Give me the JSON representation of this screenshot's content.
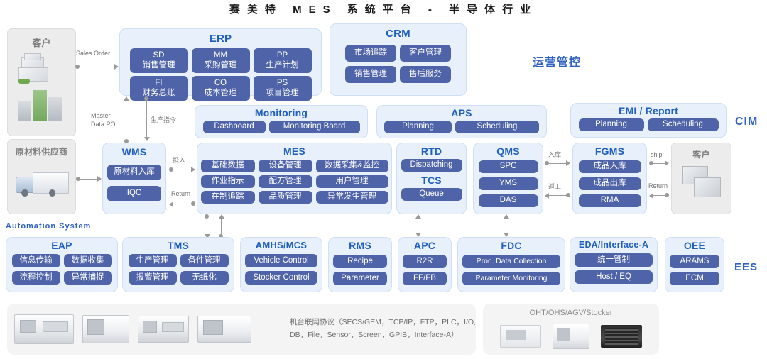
{
  "title": "赛美特 MES 系统平台 - 半导体行业",
  "side_labels": {
    "operation": "运营管控",
    "cim": "CIM",
    "ees": "EES",
    "automation": "Automation  System"
  },
  "actors": {
    "customer_left": "客户",
    "supplier": "原材料供应商",
    "customer_right": "客户"
  },
  "flow_labels": {
    "sales_order": "Sales Order",
    "master_data_po": "Master\nData PO",
    "master_data_po_l1": "Master",
    "master_data_po_l2": "Data PO",
    "production_order": "生产指令",
    "input": "投入",
    "return_wms": "Return",
    "inbound": "入库",
    "rework": "返工",
    "ship": "ship",
    "return_fg": "Return"
  },
  "panels": {
    "erp": {
      "title": "ERP",
      "items": [
        {
          "code": "SD",
          "cn": "销售管理"
        },
        {
          "code": "MM",
          "cn": "采购管理"
        },
        {
          "code": "PP",
          "cn": "生产计划"
        },
        {
          "code": "FI",
          "cn": "财务总账"
        },
        {
          "code": "CO",
          "cn": "成本管理"
        },
        {
          "code": "PS",
          "cn": "项目管理"
        }
      ]
    },
    "crm": {
      "title": "CRM",
      "items": [
        "市场追踪",
        "客户管理",
        "销售管理",
        "售后服务"
      ]
    },
    "monitoring": {
      "title": "Monitoring",
      "items": [
        "Dashboard",
        "Monitoring Board"
      ]
    },
    "aps": {
      "title": "APS",
      "items": [
        "Planning",
        "Scheduling"
      ]
    },
    "emi": {
      "title": "EMI / Report",
      "items": [
        "Planning",
        "Scheduling"
      ]
    },
    "wms": {
      "title": "WMS",
      "items": [
        "原材料入库",
        "IQC"
      ]
    },
    "mes": {
      "title": "MES",
      "items": [
        "基础数据",
        "设备管理",
        "数据采集&监控",
        "作业指示",
        "配方管理",
        "用户管理",
        "在制追踪",
        "品质管理",
        "异常发生管理"
      ]
    },
    "rtd": {
      "title": "RTD",
      "items": [
        "Dispatching"
      ],
      "title2": "TCS",
      "items2": [
        "Queue"
      ]
    },
    "qms": {
      "title": "QMS",
      "items": [
        "SPC",
        "YMS",
        "DAS"
      ]
    },
    "fgms": {
      "title": "FGMS",
      "items": [
        "成品入库",
        "成品出库",
        "RMA"
      ]
    },
    "eap": {
      "title": "EAP",
      "items": [
        "信息传输",
        "数据收集",
        "流程控制",
        "异常捕捉"
      ]
    },
    "tms": {
      "title": "TMS",
      "items": [
        "生产管理",
        "备件管理",
        "报警管理",
        "无纸化"
      ]
    },
    "amhs": {
      "title": "AMHS/MCS",
      "items": [
        "Vehicle Control",
        "Stocker Control"
      ]
    },
    "rms": {
      "title": "RMS",
      "items": [
        "Recipe",
        "Parameter"
      ]
    },
    "apc": {
      "title": "APC",
      "items": [
        "R2R",
        "FF/FB"
      ]
    },
    "fdc": {
      "title": "FDC",
      "items": [
        "Proc. Data  Collection",
        "Parameter  Monitoring"
      ]
    },
    "eda": {
      "title": "EDA/Interface-A",
      "items": [
        "统一管制",
        "Host / EQ"
      ]
    },
    "oee": {
      "title": "OEE",
      "items": [
        "ARAMS",
        "ECM"
      ]
    }
  },
  "bottom": {
    "protocol_line1": "机台联网协议（SECS/GEM，TCP/IP，FTP，PLC，I/O,",
    "protocol_line2": "DB，File，Sensor，Screen，GPIB，Interface-A）",
    "oht_title": "OHT/OHS/AGV/Stocker"
  },
  "colors": {
    "accent": "#1f5fbf",
    "pill": "#4f63a8",
    "panel_bg": "#e7f0fb",
    "grey_bg": "#ececec"
  }
}
